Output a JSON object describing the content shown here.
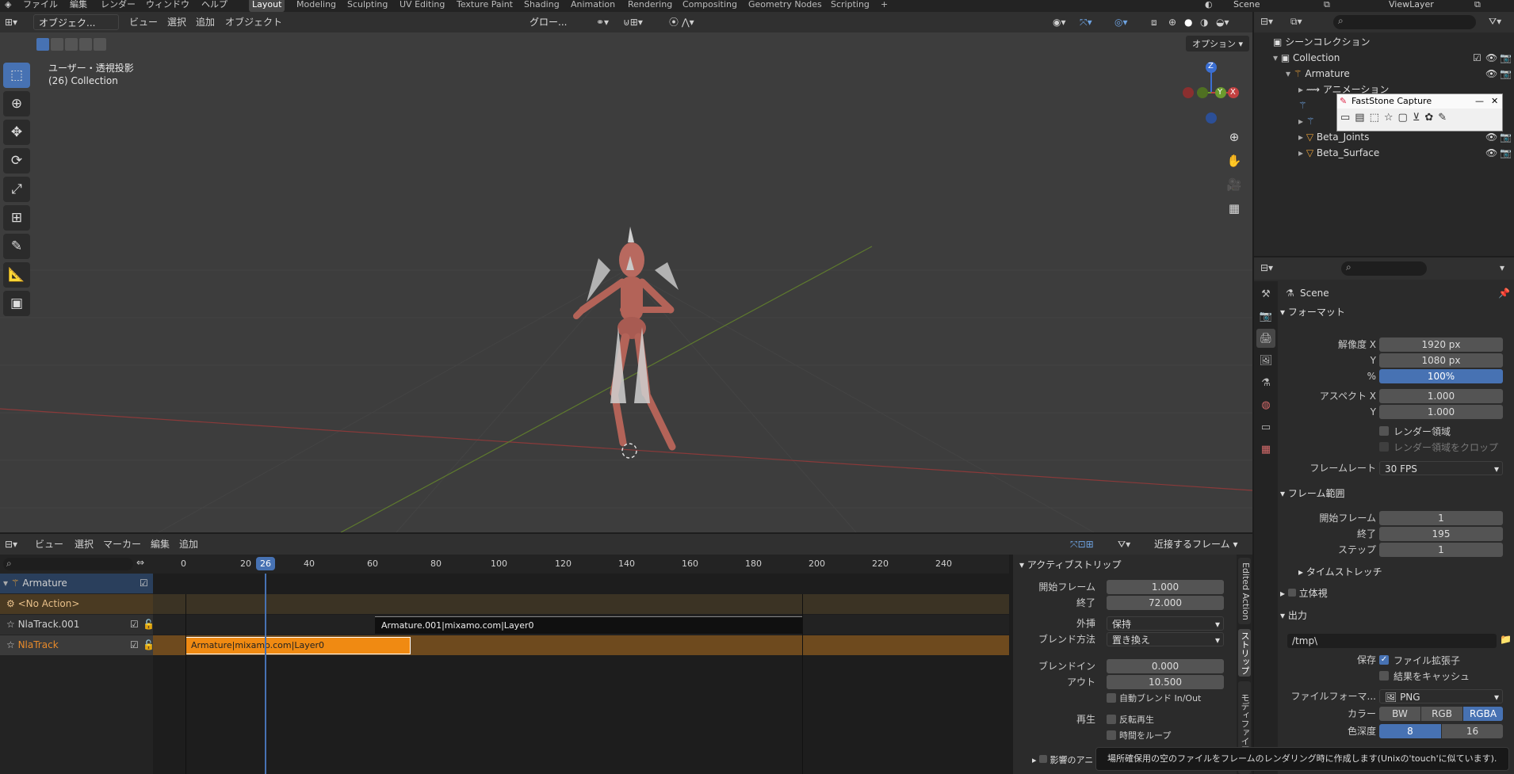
{
  "top_menu": {
    "items": [
      "ファイル",
      "編集",
      "レンダー",
      "ウィンドウ",
      "ヘルプ"
    ],
    "workspaces": [
      "Layout",
      "Modeling",
      "Sculpting",
      "UV Editing",
      "Texture Paint",
      "Shading",
      "Animation",
      "Rendering",
      "Compositing",
      "Geometry Nodes",
      "Scripting"
    ],
    "active_workspace": "Layout",
    "add_tab": "+",
    "scene_name": "Scene",
    "view_layer": "ViewLayer"
  },
  "viewport_header": {
    "mode": "オブジェク...",
    "menus": [
      "ビュー",
      "選択",
      "追加",
      "オブジェクト"
    ],
    "transform_orientation": "グロー...",
    "options": "オプション"
  },
  "viewport": {
    "view_name": "ユーザー・透視投影",
    "collection_info": "(26) Collection",
    "gizmo_z": "Z",
    "gizmo_y": "Y",
    "gizmo_x": "X"
  },
  "outliner": {
    "search_placeholder": "",
    "rows": [
      {
        "label": "シーンコレクション",
        "indent": 0
      },
      {
        "label": "Collection",
        "indent": 1
      },
      {
        "label": "Armature",
        "indent": 2
      },
      {
        "label": "アニメーション",
        "indent": 3
      },
      {
        "label": "",
        "indent": 3
      },
      {
        "label": "",
        "indent": 3
      },
      {
        "label": "Beta_Joints",
        "indent": 3
      },
      {
        "label": "Beta_Surface",
        "indent": 3
      }
    ]
  },
  "faststone": {
    "title": "FastStone Capture",
    "min": "—",
    "close": "✕"
  },
  "properties": {
    "scene_label": "Scene",
    "format_panel": "フォーマット",
    "res_x_label": "解像度 X",
    "res_x": "1920 px",
    "res_y_label": "Y",
    "res_y": "1080 px",
    "res_pct_label": "%",
    "res_pct": "100%",
    "aspect_x_label": "アスペクト X",
    "aspect_x": "1.000",
    "aspect_y_label": "Y",
    "aspect_y": "1.000",
    "render_region": "レンダー領域",
    "crop_region": "レンダー領域をクロップ",
    "framerate_label": "フレームレート",
    "framerate": "30 FPS",
    "frame_range_panel": "フレーム範囲",
    "start_label": "開始フレーム",
    "start": "1",
    "end_label": "終了",
    "end": "195",
    "step_label": "ステップ",
    "step": "1",
    "time_stretch": "タイムストレッチ",
    "stereo_panel": "立体視",
    "output_panel": "出力",
    "output_path": "/tmp\\",
    "save_label": "保存",
    "file_ext": "ファイル拡張子",
    "cache_result": "結果をキャッシュ",
    "file_format_label": "ファイルフォーマ...",
    "file_format": "PNG",
    "color_label": "カラー",
    "color_opts": [
      "BW",
      "RGB",
      "RGBA"
    ],
    "color_selected": "RGBA",
    "depth_label": "色深度",
    "depth_opts": [
      "8",
      "16"
    ],
    "depth_selected": "8"
  },
  "nla": {
    "menus": [
      "ビュー",
      "選択",
      "マーカー",
      "編集",
      "追加"
    ],
    "snap": "近接するフレーム",
    "ruler": [
      "0",
      "20",
      "40",
      "60",
      "80",
      "100",
      "120",
      "140",
      "160",
      "180",
      "200",
      "220",
      "240"
    ],
    "current_frame": "26",
    "channels": [
      {
        "name": "Armature",
        "type": "object"
      },
      {
        "name": "<No Action>",
        "type": "action"
      },
      {
        "name": "NlaTrack.001",
        "type": "track"
      },
      {
        "name": "NlaTrack",
        "type": "track"
      }
    ],
    "strip_top": "Armature.001|mixamo.com|Layer0",
    "strip_bottom": "Armature|mixamo.com|Layer0"
  },
  "strip_panel": {
    "title": "アクティブストリップ",
    "start_label": "開始フレーム",
    "start": "1.000",
    "end_label": "終了",
    "end": "72.000",
    "extrap_label": "外挿",
    "extrap": "保持",
    "blend_label": "ブレンド方法",
    "blend": "置き換え",
    "blendin_label": "ブレンドイン",
    "blendin": "0.000",
    "blendout_label": "アウト",
    "blendout": "10.500",
    "auto_blend": "自動ブレンド In/Out",
    "playback_label": "再生",
    "reverse": "反転再生",
    "loop_time": "時間をループ",
    "influence": "影響のアニ",
    "tabs": [
      "Edited Action",
      "ストリップ",
      "モディファイアー"
    ]
  },
  "tooltip": "場所確保用の空のファイルをフレームのレンダリング時に作成します(Unixの'touch'に似ています)."
}
